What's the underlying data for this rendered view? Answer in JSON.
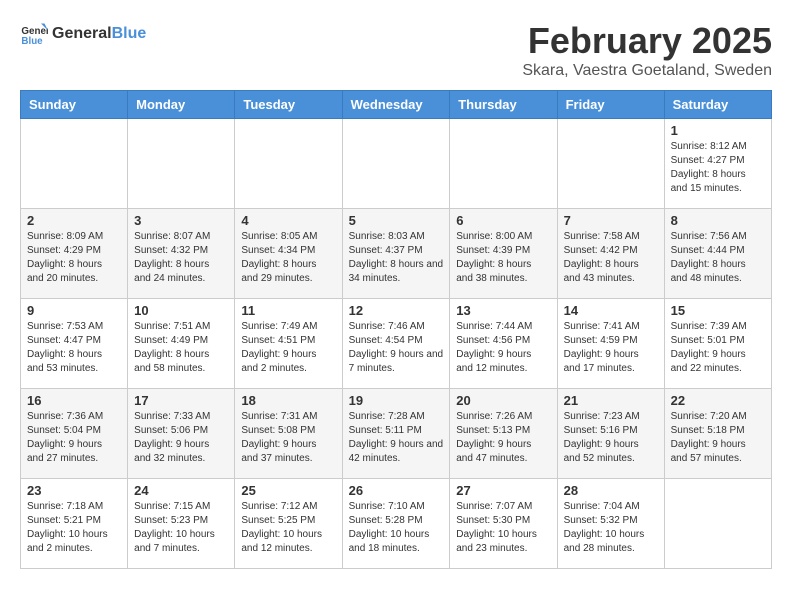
{
  "logo": {
    "text_general": "General",
    "text_blue": "Blue"
  },
  "title": {
    "month": "February 2025",
    "location": "Skara, Vaestra Goetaland, Sweden"
  },
  "headers": [
    "Sunday",
    "Monday",
    "Tuesday",
    "Wednesday",
    "Thursday",
    "Friday",
    "Saturday"
  ],
  "weeks": [
    [
      {
        "day": "",
        "info": ""
      },
      {
        "day": "",
        "info": ""
      },
      {
        "day": "",
        "info": ""
      },
      {
        "day": "",
        "info": ""
      },
      {
        "day": "",
        "info": ""
      },
      {
        "day": "",
        "info": ""
      },
      {
        "day": "1",
        "info": "Sunrise: 8:12 AM\nSunset: 4:27 PM\nDaylight: 8 hours and 15 minutes."
      }
    ],
    [
      {
        "day": "2",
        "info": "Sunrise: 8:09 AM\nSunset: 4:29 PM\nDaylight: 8 hours and 20 minutes."
      },
      {
        "day": "3",
        "info": "Sunrise: 8:07 AM\nSunset: 4:32 PM\nDaylight: 8 hours and 24 minutes."
      },
      {
        "day": "4",
        "info": "Sunrise: 8:05 AM\nSunset: 4:34 PM\nDaylight: 8 hours and 29 minutes."
      },
      {
        "day": "5",
        "info": "Sunrise: 8:03 AM\nSunset: 4:37 PM\nDaylight: 8 hours and 34 minutes."
      },
      {
        "day": "6",
        "info": "Sunrise: 8:00 AM\nSunset: 4:39 PM\nDaylight: 8 hours and 38 minutes."
      },
      {
        "day": "7",
        "info": "Sunrise: 7:58 AM\nSunset: 4:42 PM\nDaylight: 8 hours and 43 minutes."
      },
      {
        "day": "8",
        "info": "Sunrise: 7:56 AM\nSunset: 4:44 PM\nDaylight: 8 hours and 48 minutes."
      }
    ],
    [
      {
        "day": "9",
        "info": "Sunrise: 7:53 AM\nSunset: 4:47 PM\nDaylight: 8 hours and 53 minutes."
      },
      {
        "day": "10",
        "info": "Sunrise: 7:51 AM\nSunset: 4:49 PM\nDaylight: 8 hours and 58 minutes."
      },
      {
        "day": "11",
        "info": "Sunrise: 7:49 AM\nSunset: 4:51 PM\nDaylight: 9 hours and 2 minutes."
      },
      {
        "day": "12",
        "info": "Sunrise: 7:46 AM\nSunset: 4:54 PM\nDaylight: 9 hours and 7 minutes."
      },
      {
        "day": "13",
        "info": "Sunrise: 7:44 AM\nSunset: 4:56 PM\nDaylight: 9 hours and 12 minutes."
      },
      {
        "day": "14",
        "info": "Sunrise: 7:41 AM\nSunset: 4:59 PM\nDaylight: 9 hours and 17 minutes."
      },
      {
        "day": "15",
        "info": "Sunrise: 7:39 AM\nSunset: 5:01 PM\nDaylight: 9 hours and 22 minutes."
      }
    ],
    [
      {
        "day": "16",
        "info": "Sunrise: 7:36 AM\nSunset: 5:04 PM\nDaylight: 9 hours and 27 minutes."
      },
      {
        "day": "17",
        "info": "Sunrise: 7:33 AM\nSunset: 5:06 PM\nDaylight: 9 hours and 32 minutes."
      },
      {
        "day": "18",
        "info": "Sunrise: 7:31 AM\nSunset: 5:08 PM\nDaylight: 9 hours and 37 minutes."
      },
      {
        "day": "19",
        "info": "Sunrise: 7:28 AM\nSunset: 5:11 PM\nDaylight: 9 hours and 42 minutes."
      },
      {
        "day": "20",
        "info": "Sunrise: 7:26 AM\nSunset: 5:13 PM\nDaylight: 9 hours and 47 minutes."
      },
      {
        "day": "21",
        "info": "Sunrise: 7:23 AM\nSunset: 5:16 PM\nDaylight: 9 hours and 52 minutes."
      },
      {
        "day": "22",
        "info": "Sunrise: 7:20 AM\nSunset: 5:18 PM\nDaylight: 9 hours and 57 minutes."
      }
    ],
    [
      {
        "day": "23",
        "info": "Sunrise: 7:18 AM\nSunset: 5:21 PM\nDaylight: 10 hours and 2 minutes."
      },
      {
        "day": "24",
        "info": "Sunrise: 7:15 AM\nSunset: 5:23 PM\nDaylight: 10 hours and 7 minutes."
      },
      {
        "day": "25",
        "info": "Sunrise: 7:12 AM\nSunset: 5:25 PM\nDaylight: 10 hours and 12 minutes."
      },
      {
        "day": "26",
        "info": "Sunrise: 7:10 AM\nSunset: 5:28 PM\nDaylight: 10 hours and 18 minutes."
      },
      {
        "day": "27",
        "info": "Sunrise: 7:07 AM\nSunset: 5:30 PM\nDaylight: 10 hours and 23 minutes."
      },
      {
        "day": "28",
        "info": "Sunrise: 7:04 AM\nSunset: 5:32 PM\nDaylight: 10 hours and 28 minutes."
      },
      {
        "day": "",
        "info": ""
      }
    ]
  ]
}
